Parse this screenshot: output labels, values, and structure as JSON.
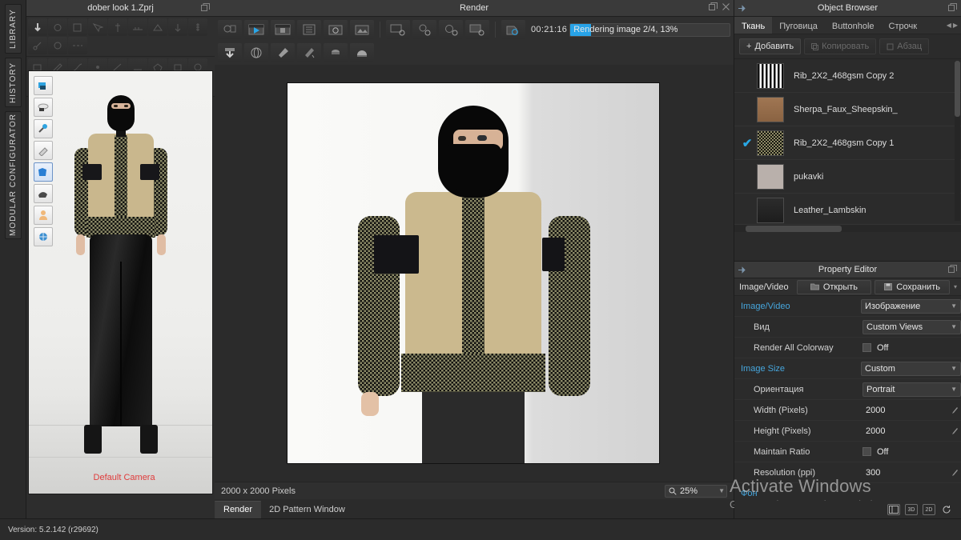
{
  "rail": {
    "tabs": [
      {
        "label": "LIBRARY"
      },
      {
        "label": "HISTORY"
      },
      {
        "label": "MODULAR CONFIGURATOR"
      }
    ]
  },
  "left_panel": {
    "title": "dober look 1.Zprj",
    "camera_label": "Default Camera",
    "toolbar_row1_icons": [
      "move-tool-icon",
      "rotate-tool-icon",
      "scale-tool-icon",
      "select-mesh-icon",
      "pin-icon",
      "tape-measure-icon",
      "fold-arrange-icon",
      "gravity-icon",
      "zipper-icon",
      "trim-icon",
      "button-icon",
      "stitch-icon"
    ],
    "toolbar_row2_icons": [
      "transform-pattern-icon",
      "edit-pattern-icon",
      "edit-curve-icon",
      "add-point-icon",
      "internal-line-icon",
      "baseline-icon",
      "polygon-icon",
      "rectangle-icon",
      "circle-icon",
      "pleat-icon",
      "dart-icon",
      "marker-icon"
    ],
    "viewport_tools": [
      "simulation-icon",
      "cloth-icon",
      "pin-tool-icon",
      "brush-icon",
      "garment-icon",
      "fabric-icon",
      "avatar-icon",
      "environment-icon"
    ]
  },
  "render_window": {
    "title": "Render",
    "window_buttons": [
      "float-window-icon",
      "close-icon"
    ],
    "toolbar": {
      "row1": [
        {
          "name": "render-settings-icon"
        },
        {
          "name": "render-play-icon"
        },
        {
          "name": "render-video-icon"
        },
        {
          "name": "render-list-icon"
        },
        {
          "name": "snapshot-icon"
        },
        {
          "name": "image-export-icon"
        },
        {
          "name": "image-settings-icon"
        },
        {
          "name": "render-gear-icon"
        },
        {
          "name": "camera-settings-icon"
        },
        {
          "name": "video-settings-icon"
        },
        {
          "name": "render-timer-icon"
        }
      ],
      "row2": [
        {
          "name": "download-icon"
        },
        {
          "name": "globe-icon"
        },
        {
          "name": "light-cone-icon"
        },
        {
          "name": "light-ray-icon"
        },
        {
          "name": "disk-light-icon"
        },
        {
          "name": "dome-light-icon"
        }
      ]
    },
    "timer": "00:21:16",
    "progress_text": "Rendering image 2/4, 13%",
    "progress_percent": 13,
    "progress_color": "#27a3e8",
    "status_dimensions": "2000 x 2000 Pixels",
    "zoom_value": "25%",
    "zoom_icon": "magnifier-icon",
    "tabs": [
      {
        "label": "Render",
        "active": true
      },
      {
        "label": "2D Pattern Window",
        "active": false
      }
    ]
  },
  "object_browser": {
    "title": "Object Browser",
    "pin_icon": "pin-icon",
    "float_icon": "float-window-icon",
    "tabs": [
      {
        "label": "Ткань",
        "active": true
      },
      {
        "label": "Пуговица",
        "active": false
      },
      {
        "label": "Buttonhole",
        "active": false
      },
      {
        "label": "Строчк",
        "active": false
      }
    ],
    "scroll_left_icon": "chevron-left-icon",
    "scroll_right_icon": "chevron-right-icon",
    "buttons": [
      {
        "label": "Добавить",
        "icon": "plus-icon",
        "disabled": false
      },
      {
        "label": "Копировать",
        "icon": "copy-icon",
        "disabled": true
      },
      {
        "label": "Абзац",
        "icon": "paste-icon",
        "disabled": true
      }
    ],
    "items": [
      {
        "name": "Leather_Lambskin",
        "checked": false,
        "thumb": "th-leather"
      },
      {
        "name": "pukavki",
        "checked": false,
        "thumb": "th-solid"
      },
      {
        "name": "Rib_2X2_468gsm Copy 1",
        "checked": true,
        "thumb": "th-rib1"
      },
      {
        "name": "Sherpa_Faux_Sheepskin_",
        "checked": false,
        "thumb": "th-sherpa"
      },
      {
        "name": "Rib_2X2_468gsm Copy 2",
        "checked": false,
        "thumb": "th-rib2"
      }
    ],
    "check_glyph": "✔",
    "check_color": "#29a8e6"
  },
  "property_editor": {
    "title": "Property Editor",
    "pin_icon": "pin-icon",
    "float_icon": "float-window-icon",
    "tab_label": "Image/Video",
    "open_button": {
      "label": "Открыть",
      "icon": "folder-open-icon"
    },
    "save_button": {
      "label": "Сохранить",
      "icon": "save-disk-icon"
    },
    "rows": [
      {
        "label": "Image/Video",
        "value": "Изображение",
        "kind": "select",
        "group": true
      },
      {
        "label": "Вид",
        "value": "Custom Views",
        "kind": "select",
        "group": false
      },
      {
        "label": "Render All Colorway",
        "value": "Off",
        "kind": "checkbox",
        "group": false
      },
      {
        "label": "Image Size",
        "value": "Custom",
        "kind": "select",
        "group": true
      },
      {
        "label": "Ориентация",
        "value": "Portrait",
        "kind": "select",
        "group": false
      },
      {
        "label": "Width (Pixels)",
        "value": "2000",
        "kind": "text",
        "group": false
      },
      {
        "label": "Height (Pixels)",
        "value": "2000",
        "kind": "text",
        "group": false
      },
      {
        "label": "Maintain Ratio",
        "value": "Off",
        "kind": "checkbox",
        "group": false
      },
      {
        "label": "Resolution (ppi)",
        "value": "300",
        "kind": "text",
        "group": false
      },
      {
        "label": "Фон",
        "value": "",
        "kind": "group-only",
        "group": true
      }
    ],
    "bottom_icons": [
      "split-view-icon",
      "3D",
      "2D",
      "refresh-icon"
    ]
  },
  "watermark": {
    "line1": "Activate Windows",
    "line2": "Go to Settings to activate Windows."
  },
  "statusbar": {
    "version": "Version: 5.2.142 (r29692)"
  }
}
